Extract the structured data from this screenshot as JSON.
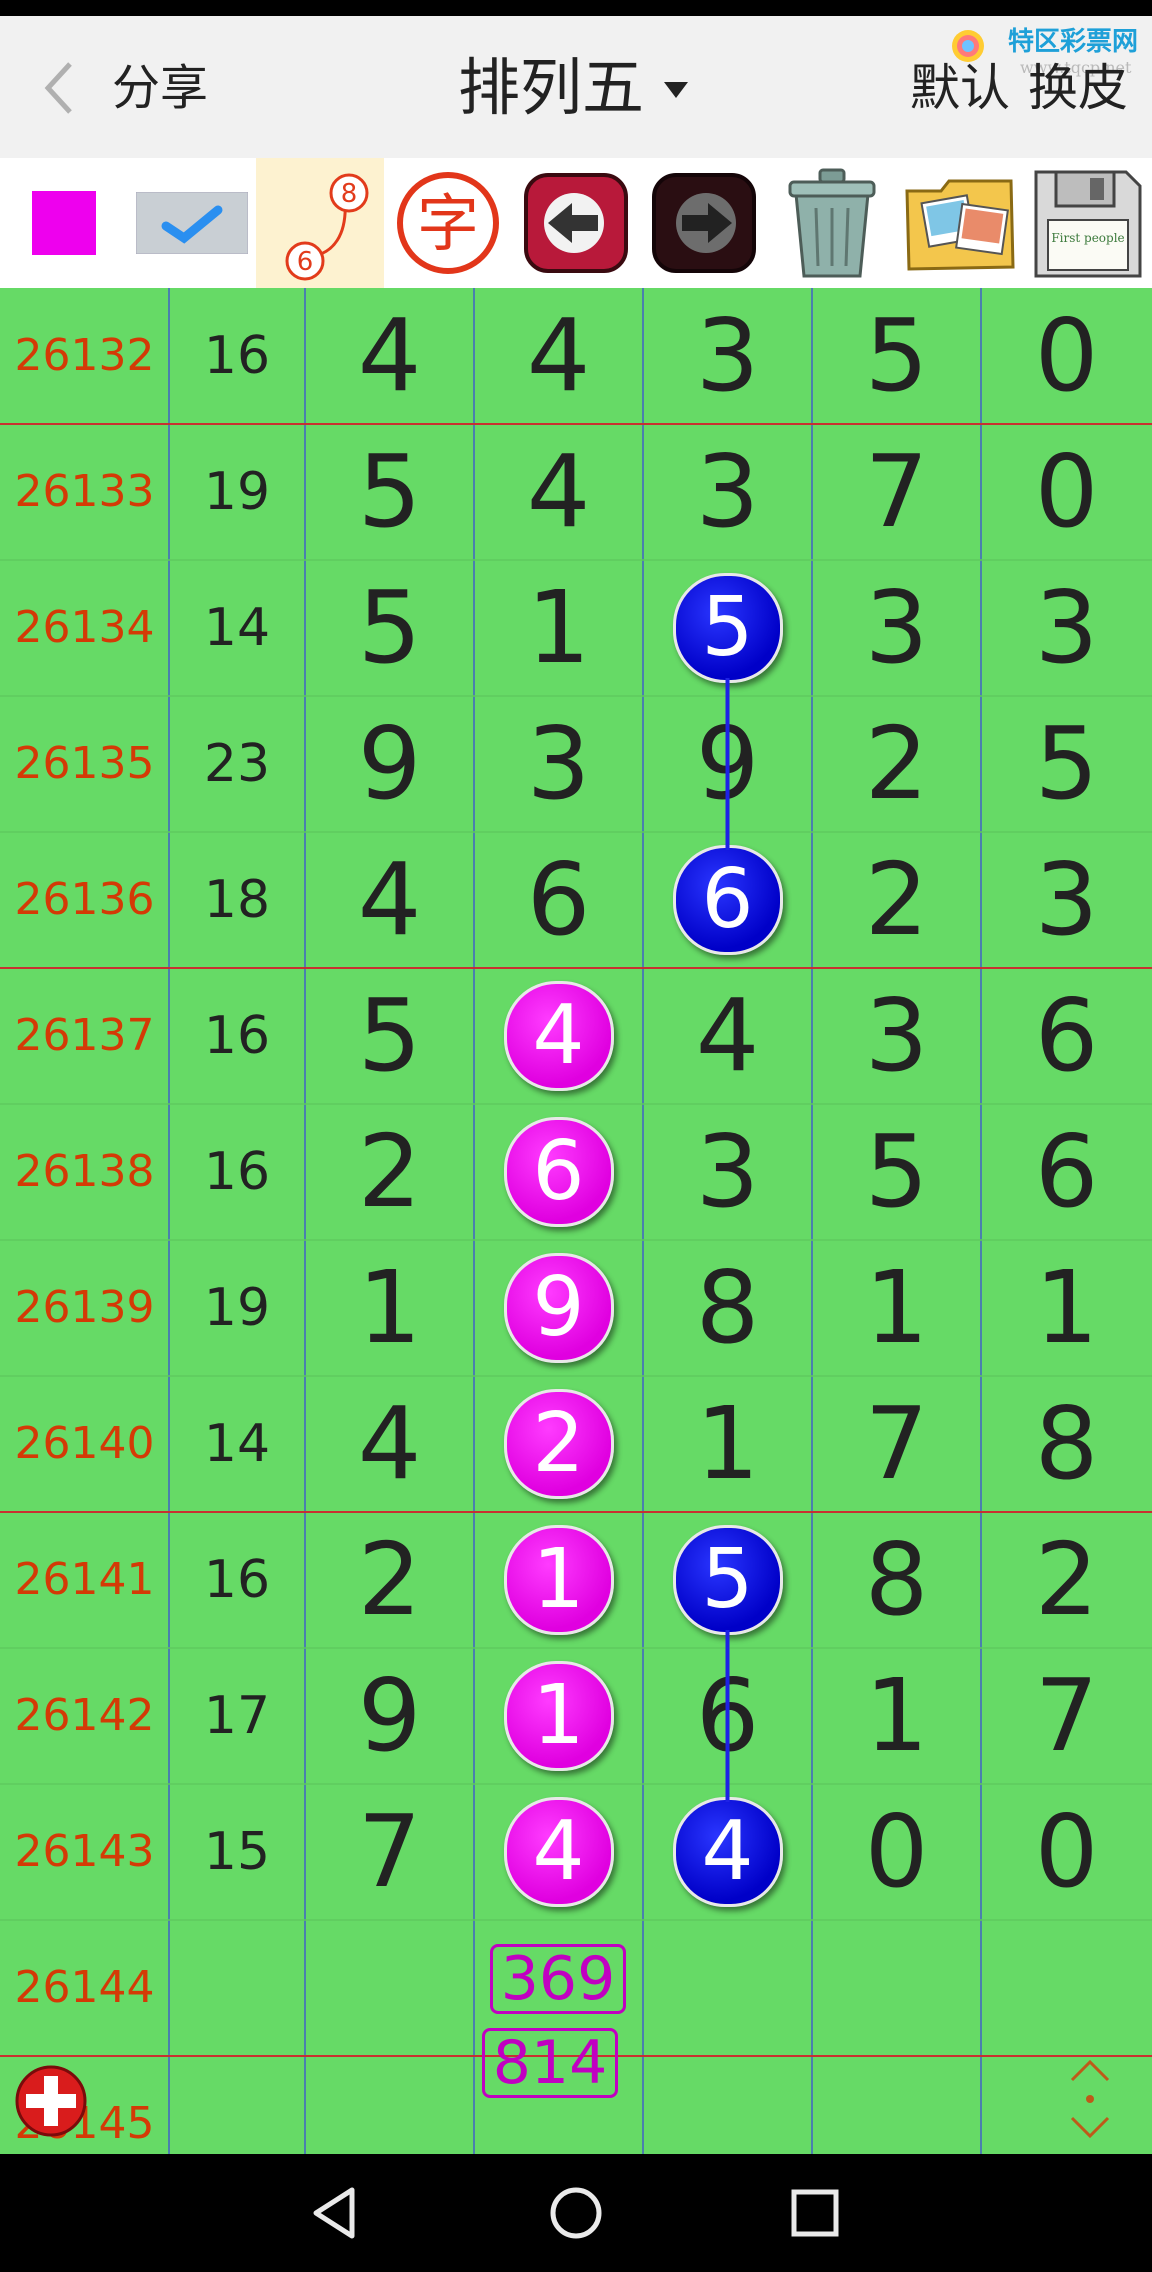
{
  "header": {
    "back_label": "分享",
    "title": "排列五",
    "default_label": "默认",
    "skin_label": "换皮",
    "brand_name": "特区彩票网",
    "brand_url": "www.tqcp.net"
  },
  "toolbar": {
    "color_swatch": "#ee00ee",
    "tool_char_label": "字",
    "path_icon_numbers": [
      "8",
      "6"
    ],
    "folder_label": "First people"
  },
  "columns": [
    "issue",
    "sum",
    "d1",
    "d2",
    "d3",
    "d4",
    "d5"
  ],
  "rows": [
    {
      "issue": "26132",
      "sum": "16",
      "digits": [
        "4",
        "4",
        "3",
        "5",
        "0"
      ]
    },
    {
      "issue": "26133",
      "sum": "19",
      "digits": [
        "5",
        "4",
        "3",
        "7",
        "0"
      ]
    },
    {
      "issue": "26134",
      "sum": "14",
      "digits": [
        "5",
        "1",
        "5",
        "3",
        "3"
      ]
    },
    {
      "issue": "26135",
      "sum": "23",
      "digits": [
        "9",
        "3",
        "9",
        "2",
        "5"
      ]
    },
    {
      "issue": "26136",
      "sum": "18",
      "digits": [
        "4",
        "6",
        "6",
        "2",
        "3"
      ]
    },
    {
      "issue": "26137",
      "sum": "16",
      "digits": [
        "5",
        "4",
        "4",
        "3",
        "6"
      ]
    },
    {
      "issue": "26138",
      "sum": "16",
      "digits": [
        "2",
        "6",
        "3",
        "5",
        "6"
      ]
    },
    {
      "issue": "26139",
      "sum": "19",
      "digits": [
        "1",
        "9",
        "8",
        "1",
        "1"
      ]
    },
    {
      "issue": "26140",
      "sum": "14",
      "digits": [
        "4",
        "2",
        "1",
        "7",
        "8"
      ]
    },
    {
      "issue": "26141",
      "sum": "16",
      "digits": [
        "2",
        "1",
        "5",
        "8",
        "2"
      ]
    },
    {
      "issue": "26142",
      "sum": "17",
      "digits": [
        "9",
        "1",
        "6",
        "1",
        "7"
      ]
    },
    {
      "issue": "26143",
      "sum": "15",
      "digits": [
        "7",
        "4",
        "4",
        "0",
        "0"
      ]
    },
    {
      "issue": "26144",
      "sum": "",
      "digits": [
        "",
        "",
        "",
        "",
        ""
      ]
    },
    {
      "issue": "26145",
      "sum": "",
      "digits": [
        "",
        "",
        "",
        "",
        ""
      ]
    }
  ],
  "highlights": [
    {
      "row": 2,
      "col": 2,
      "color": "blue"
    },
    {
      "row": 4,
      "col": 2,
      "color": "blue"
    },
    {
      "row": 5,
      "col": 1,
      "color": "magenta"
    },
    {
      "row": 6,
      "col": 1,
      "color": "magenta"
    },
    {
      "row": 7,
      "col": 1,
      "color": "magenta"
    },
    {
      "row": 8,
      "col": 1,
      "color": "magenta"
    },
    {
      "row": 9,
      "col": 1,
      "color": "magenta"
    },
    {
      "row": 9,
      "col": 2,
      "color": "blue"
    },
    {
      "row": 10,
      "col": 1,
      "color": "magenta"
    },
    {
      "row": 11,
      "col": 1,
      "color": "magenta"
    },
    {
      "row": 11,
      "col": 2,
      "color": "blue"
    }
  ],
  "links": [
    {
      "col": 2,
      "from_row": 2,
      "to_row": 4
    },
    {
      "col": 2,
      "from_row": 9,
      "to_row": 11
    }
  ],
  "predictions": [
    "369",
    "814"
  ],
  "colors": {
    "grid_bg": "#66da66",
    "issue_text": "#d43a06",
    "blue_ball": "#0000c8",
    "magenta_ball": "#e000e0",
    "separator_red": "#c83030",
    "separator_blue": "#3a4fd8"
  }
}
